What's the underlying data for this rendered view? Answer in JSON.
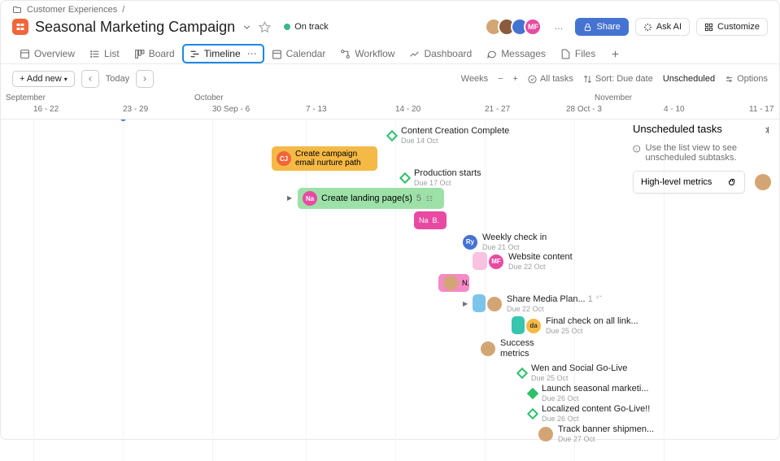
{
  "breadcrumb": {
    "parent": "Customer Experiences"
  },
  "project": {
    "title": "Seasonal Marketing Campaign",
    "status": "On track"
  },
  "header": {
    "share": "Share",
    "ask_ai": "Ask AI",
    "customize": "Customize",
    "more": "…"
  },
  "tabs": {
    "overview": "Overview",
    "list": "List",
    "board": "Board",
    "timeline": "Timeline",
    "calendar": "Calendar",
    "workflow": "Workflow",
    "dashboard": "Dashboard",
    "messages": "Messages",
    "files": "Files"
  },
  "toolbar": {
    "add_new": "Add new",
    "today": "Today",
    "weeks": "Weeks",
    "all_tasks": "All tasks",
    "sort": "Sort: Due date",
    "unscheduled": "Unscheduled",
    "options": "Options"
  },
  "months": {
    "sep": "September",
    "oct": "October",
    "nov": "November"
  },
  "weeks": {
    "w1": "16 - 22",
    "w2": "23 - 29",
    "w3": "30 Sep - 6",
    "w4": "7 - 13",
    "w5": "14 - 20",
    "w6": "21 - 27",
    "w7": "28 Oct - 3",
    "w8": "4 - 10",
    "w9": "11 - 17"
  },
  "tasks": {
    "content_complete": {
      "name": "Content Creation Complete",
      "due": "Due 14 Oct"
    },
    "campaign_email": {
      "name": "Create campaign email nurture path",
      "av": "CJ"
    },
    "production": {
      "name": "Production starts",
      "due": "Due 17 Oct"
    },
    "landing": {
      "name": "Create landing page(s)",
      "count": "5",
      "av": "Na"
    },
    "nab": {
      "av": "Na",
      "txt": "B."
    },
    "checkin": {
      "name": "Weekly check in",
      "due": "Due 21 Oct",
      "av": "Ry"
    },
    "website": {
      "name": "Website content",
      "due": "Due 22 Oct",
      "av": "MF"
    },
    "n_task": {
      "txt": "N."
    },
    "share_media": {
      "name": "Share Media Plan...",
      "count": "1",
      "due": "Due 22 Oct"
    },
    "final_check": {
      "name": "Final check on all link...",
      "due": "Due 25 Oct",
      "av": "da"
    },
    "success": {
      "name": "Success metrics"
    },
    "wen_social": {
      "name": "Wen and Social Go-Live",
      "due": "Due 25 Oct"
    },
    "launch": {
      "name": "Launch seasonal marketi...",
      "due": "Due 26 Oct"
    },
    "localized": {
      "name": "Localized content Go-Live!!",
      "due": "Due 26 Oct"
    },
    "track_banner": {
      "name": "Track banner shipmen...",
      "due": "Due 27 Oct"
    }
  },
  "side": {
    "title": "Unscheduled tasks",
    "tip": "Use the list view to see unscheduled subtasks.",
    "task1": "High-level metrics"
  }
}
